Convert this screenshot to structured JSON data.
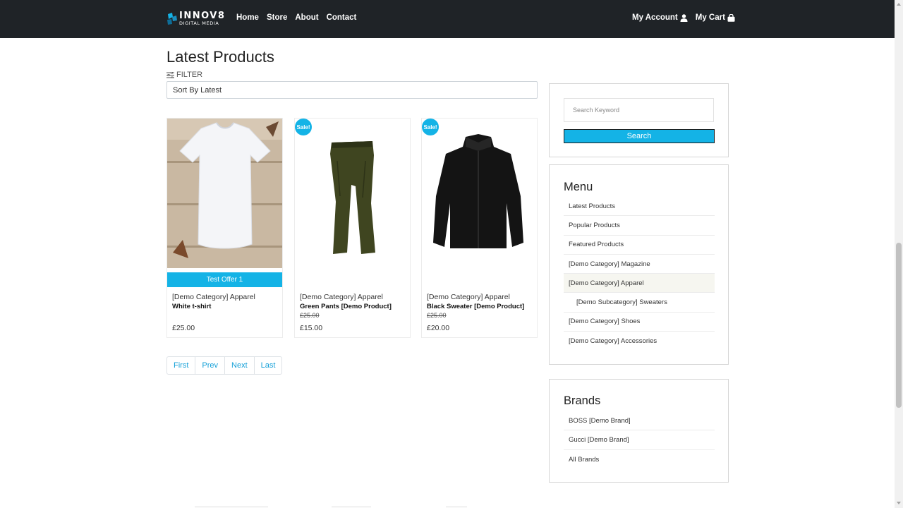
{
  "brand": {
    "logo_line1": "INNOV8",
    "logo_line2": "DIGITAL MEDIA"
  },
  "nav": {
    "links": [
      "Home",
      "Store",
      "About",
      "Contact"
    ],
    "account_label": "My Account",
    "cart_label": "My Cart"
  },
  "page": {
    "title": "Latest Products",
    "filter_label": "FILTER",
    "sort_value": "Sort By Latest"
  },
  "products": [
    {
      "category": "[Demo Category] Apparel",
      "name": "White t-shirt",
      "old_price": "",
      "price": "£25.00",
      "badge": "",
      "offer": "Test Offer 1"
    },
    {
      "category": "[Demo Category] Apparel",
      "name": "Green Pants [Demo Product]",
      "old_price": "£25.00",
      "price": "£15.00",
      "badge": "Sale!",
      "offer": ""
    },
    {
      "category": "[Demo Category] Apparel",
      "name": "Black Sweater [Demo Product]",
      "old_price": "£25.00",
      "price": "£20.00",
      "badge": "Sale!",
      "offer": ""
    }
  ],
  "pagination": {
    "first": "First",
    "prev": "Prev",
    "next": "Next",
    "last": "Last"
  },
  "sidebar": {
    "search_placeholder": "Search Keyword",
    "search_button": "Search",
    "menu_title": "Menu",
    "menu_items": [
      "Latest Products",
      "Popular Products",
      "Featured Products",
      "[Demo Category] Magazine",
      "[Demo Category] Apparel",
      "[Demo Subcategory] Sweaters",
      "[Demo Category] Shoes",
      "[Demo Category] Accessories"
    ],
    "brands_title": "Brands",
    "brand_items": [
      "BOSS [Demo Brand]",
      "Gucci [Demo Brand]",
      "All Brands"
    ]
  },
  "colors": {
    "navbar": "#1f2327",
    "accent": "#14b3e6",
    "link": "#14a0d8"
  },
  "icons": {
    "account": "user-icon",
    "cart": "shopping-bag-icon",
    "filter": "sliders-icon"
  }
}
